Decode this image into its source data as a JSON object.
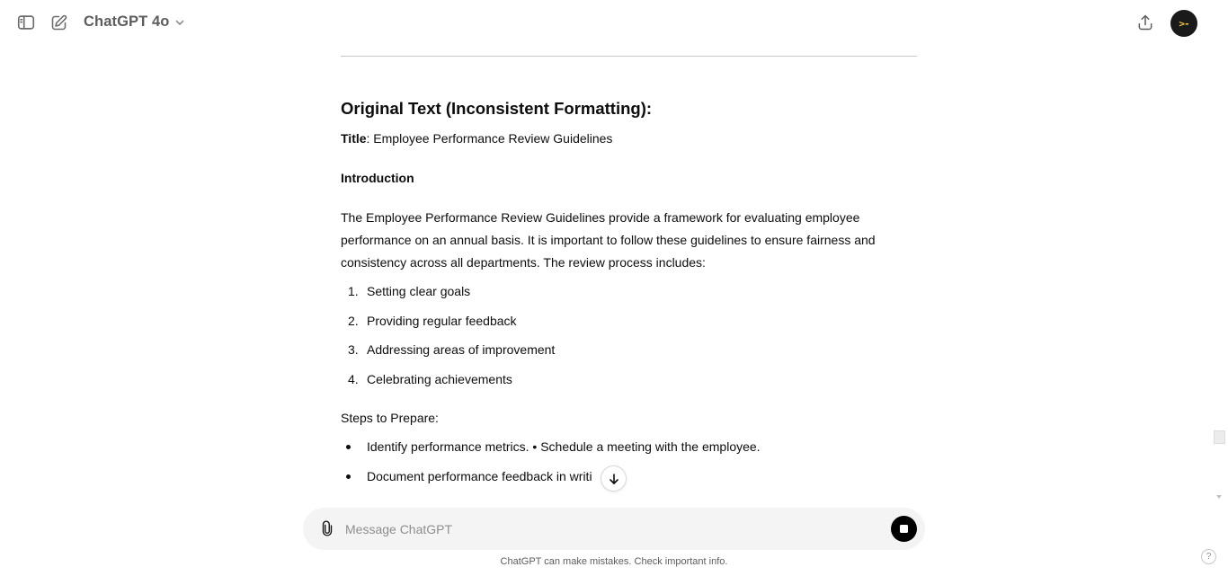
{
  "header": {
    "model_name": "ChatGPT 4o",
    "icons": [
      "sidebar-toggle-icon",
      "new-chat-icon",
      "chevron-down-icon",
      "share-icon"
    ],
    "avatar_text": ">-"
  },
  "message": {
    "heading": "Original Text (Inconsistent Formatting):",
    "title_label": "Title",
    "title_value": ": Employee Performance Review Guidelines",
    "intro_heading": "Introduction",
    "paragraph": "The Employee Performance Review Guidelines provide a framework for evaluating employee performance on an annual basis. It is important to follow these guidelines to ensure fairness and consistency across all departments. The review process includes:",
    "numbered_items": [
      {
        "num": "1.",
        "text": "Setting clear goals"
      },
      {
        "num": "2.",
        "text": "Providing regular feedback"
      },
      {
        "num": "3.",
        "text": "Addressing areas of improvement"
      },
      {
        "num": "4.",
        "text": "Celebrating achievements"
      }
    ],
    "steps_heading": "Steps to Prepare:",
    "bullet_items": [
      "Identify performance metrics. • Schedule a meeting with the employee.",
      "Document performance feedback in writi"
    ]
  },
  "composer": {
    "placeholder": "Message ChatGPT"
  },
  "footer": {
    "disclaimer": "ChatGPT can make mistakes. Check important info.",
    "help_label": "?"
  },
  "colors": {
    "accent": "#000000",
    "avatar_bg": "#1a1a1a",
    "avatar_fg": "#f5c542",
    "composer_bg": "#f4f4f4"
  }
}
